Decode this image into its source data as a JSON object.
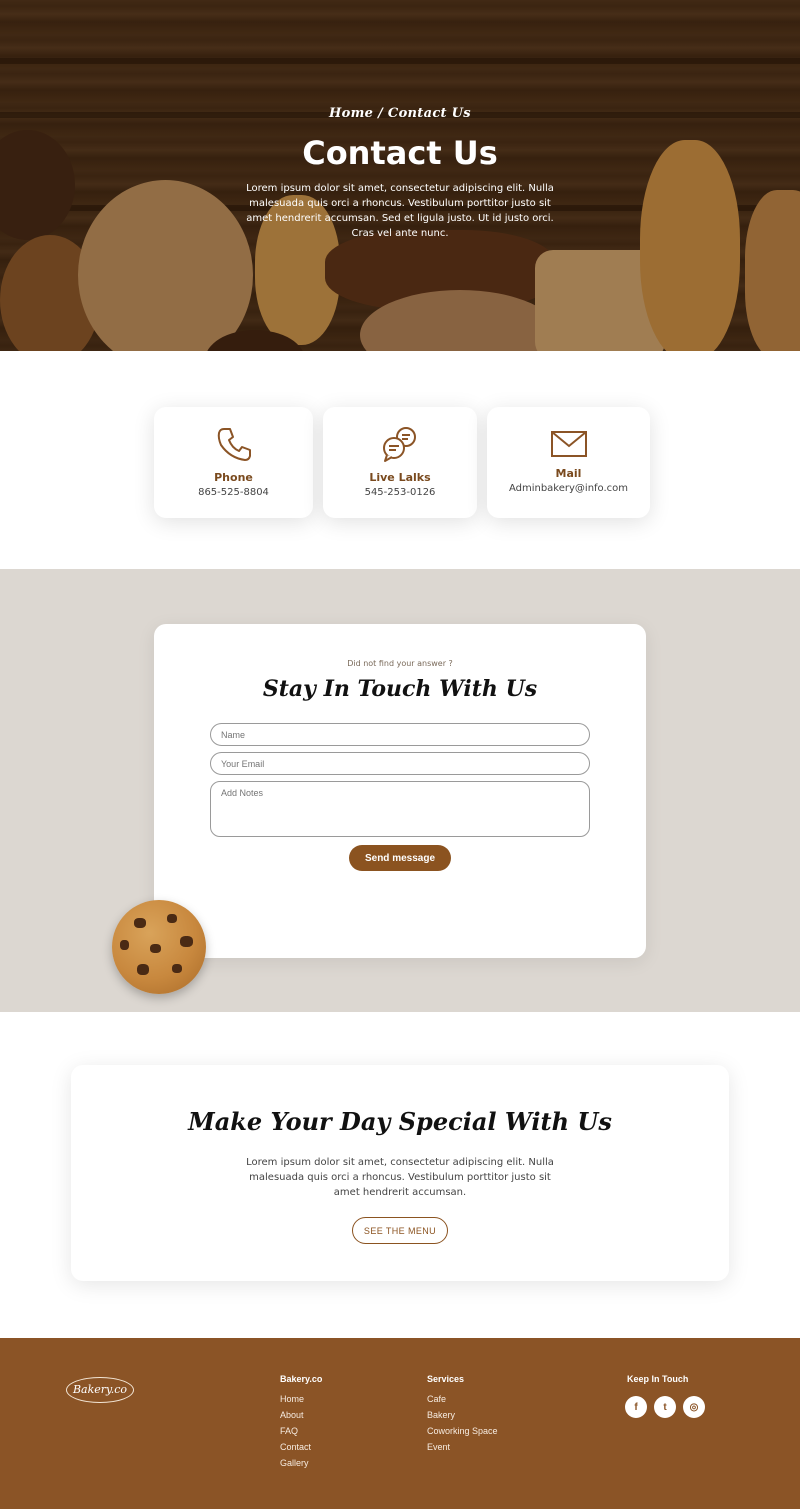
{
  "hero": {
    "breadcrumb": "Home / Contact Us",
    "title": "Contact Us",
    "text": "Lorem ipsum dolor sit amet, consectetur adipiscing elit. Nulla malesuada quis orci a rhoncus. Vestibulum porttitor justo sit amet hendrerit accumsan. Sed et ligula justo. Ut id justo orci. Cras vel ante nunc."
  },
  "contact_cards": [
    {
      "icon": "phone-icon",
      "title": "Phone",
      "value": "865-525-8804"
    },
    {
      "icon": "chat-icon",
      "title": "Live Lalks",
      "value": "545-253-0126"
    },
    {
      "icon": "mail-icon",
      "title": "Mail",
      "value": "Adminbakery@info.com"
    }
  ],
  "form": {
    "subtitle": "Did not find your answer ?",
    "title": "Stay In Touch With Us",
    "name_placeholder": "Name",
    "email_placeholder": "Your Email",
    "notes_placeholder": "Add Notes",
    "submit_label": "Send message"
  },
  "special": {
    "title": "Make Your Day Special With Us",
    "text": "Lorem ipsum dolor sit amet, consectetur adipiscing elit. Nulla malesuada quis orci a rhoncus. Vestibulum porttitor justo sit amet hendrerit accumsan.",
    "button_label": "SEE THE MENU"
  },
  "footer": {
    "logo": "Bakery.co",
    "columns": [
      {
        "heading": "Bakery.co",
        "links": [
          "Home",
          "About",
          "FAQ",
          "Contact",
          "Gallery"
        ]
      },
      {
        "heading": "Services",
        "links": [
          "Cafe",
          "Bakery",
          "Coworking Space",
          "Event"
        ]
      }
    ],
    "keep_in_touch": "Keep In Touch",
    "social": [
      {
        "icon": "facebook-icon",
        "glyph": "f"
      },
      {
        "icon": "twitter-icon",
        "glyph": "t"
      },
      {
        "icon": "instagram-icon",
        "glyph": "◎"
      }
    ]
  },
  "colors": {
    "brand_brown": "#8b5426",
    "form_section_bg": "#dcd7d1",
    "button_brown": "#8b5320"
  }
}
